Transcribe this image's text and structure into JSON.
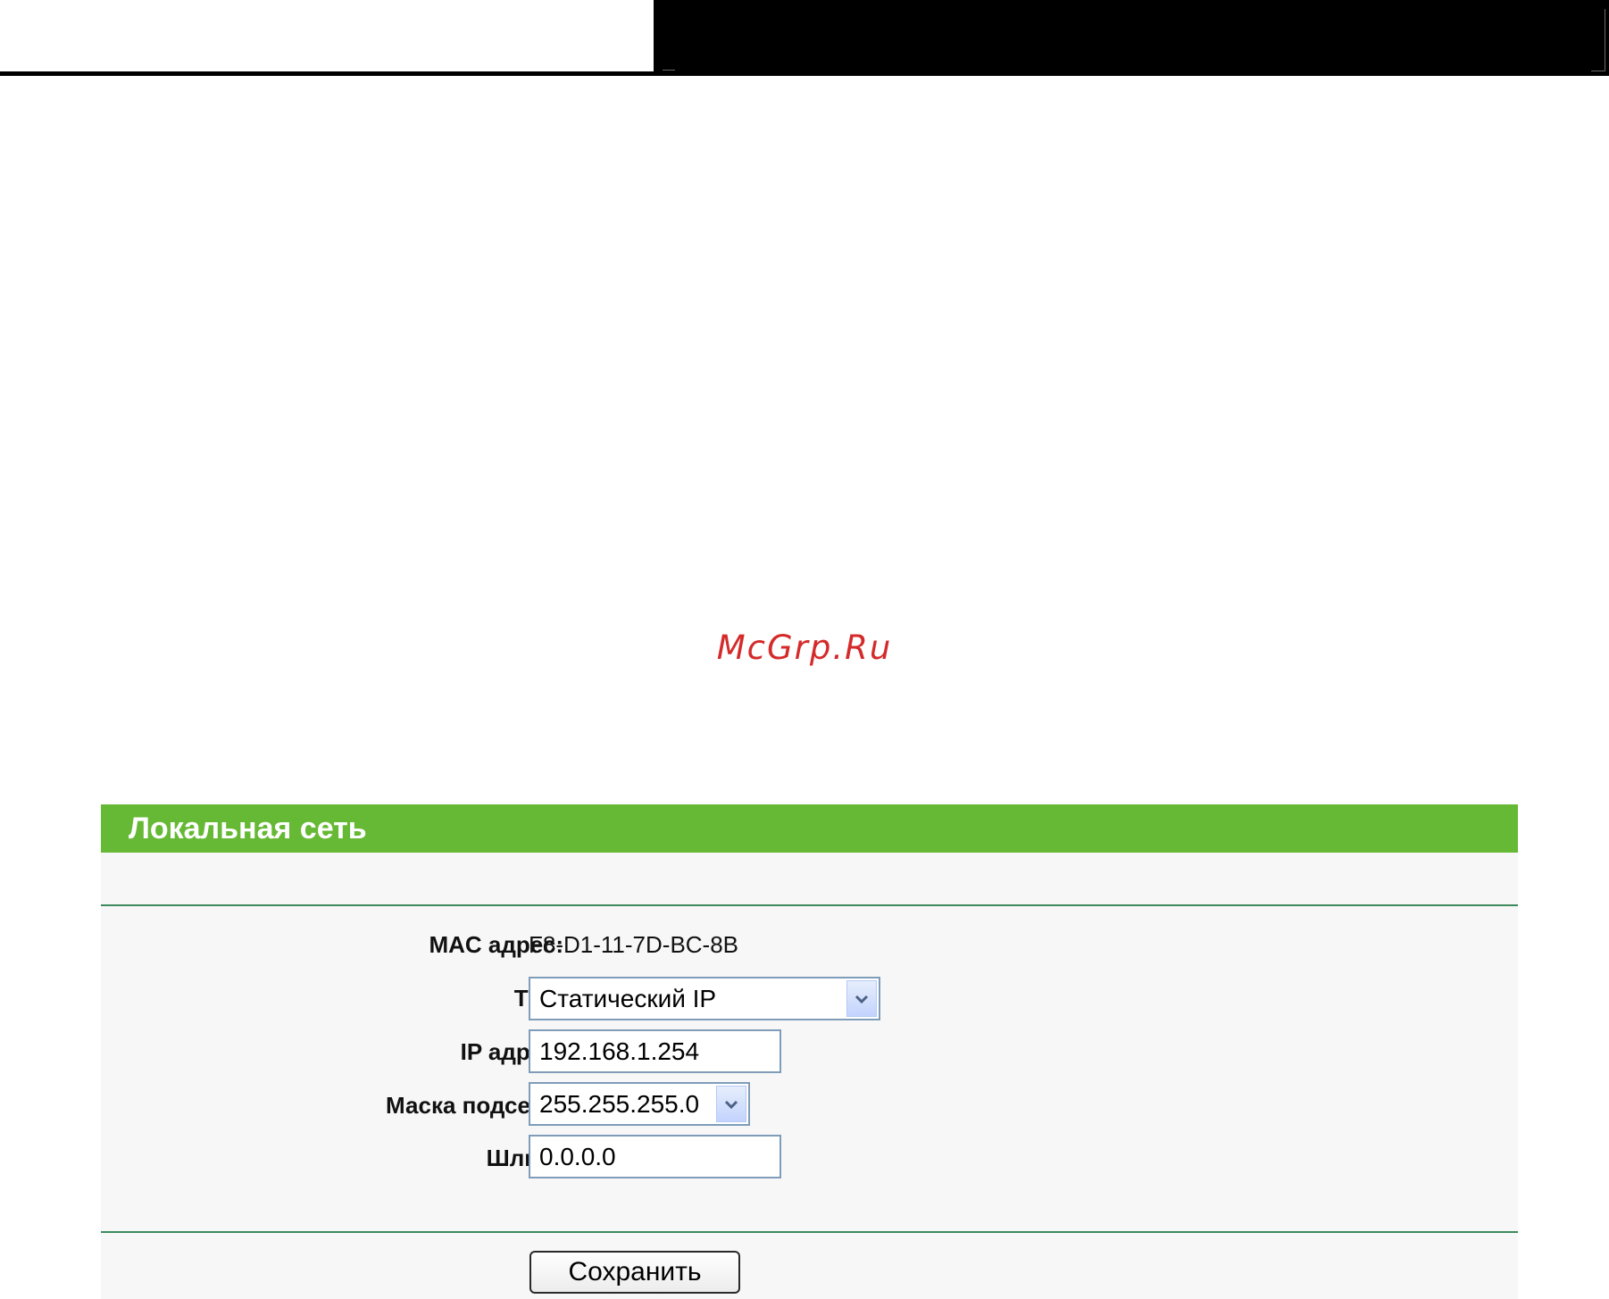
{
  "watermark": "McGrp.Ru",
  "panel": {
    "title": "Локальная сеть",
    "header_color": "#66b934",
    "rule_color": "#3e8a5e"
  },
  "form": {
    "mac_label": "MAC адрес:",
    "mac_value": "F8-D1-11-7D-BC-8B",
    "type_label": "Тип:",
    "type_value": "Статический IP",
    "ip_label": "IP адрес:",
    "ip_value": "192.168.1.254",
    "mask_label": "Маска подсети:",
    "mask_value": "255.255.255.0",
    "gateway_label": "Шлюз:",
    "gateway_value": "0.0.0.0"
  },
  "actions": {
    "save_label": "Сохранить"
  },
  "icons": {
    "dropdown": "chevron-down-icon"
  }
}
